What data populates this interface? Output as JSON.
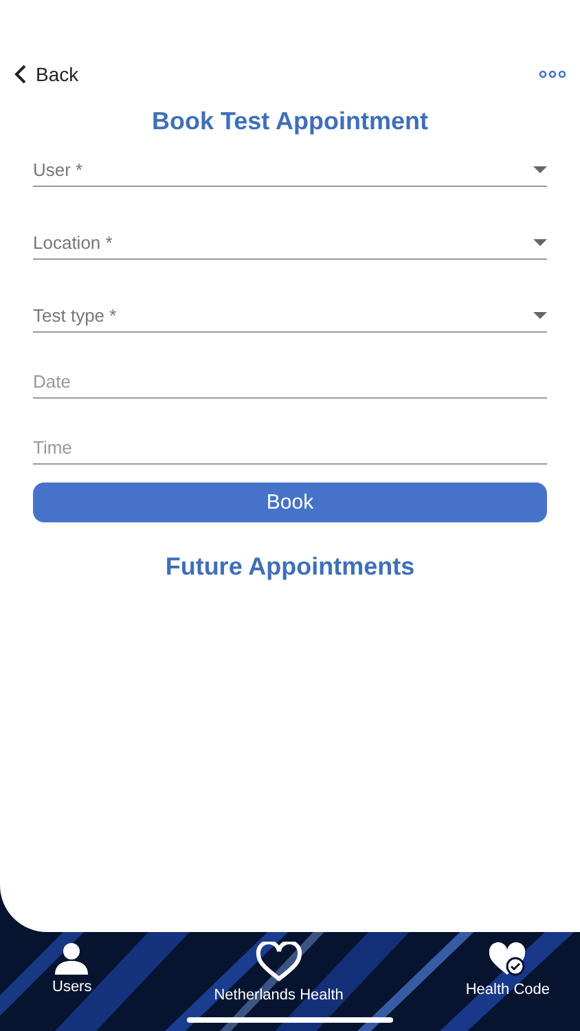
{
  "header": {
    "back": "Back"
  },
  "title": "Book Test Appointment",
  "fields": [
    {
      "kind": "select",
      "placeholder": "User *"
    },
    {
      "kind": "select",
      "placeholder": "Location *"
    },
    {
      "kind": "select",
      "placeholder": "Test type *"
    },
    {
      "kind": "text",
      "placeholder": "Date"
    },
    {
      "kind": "text",
      "placeholder": "Time"
    }
  ],
  "book_button": "Book",
  "future_title": "Future Appointments",
  "tab_bar": [
    {
      "kind": "users",
      "label": "Users"
    },
    {
      "kind": "heart",
      "label": "Netherlands Health"
    },
    {
      "kind": "health-code",
      "label": "Health Code"
    }
  ]
}
